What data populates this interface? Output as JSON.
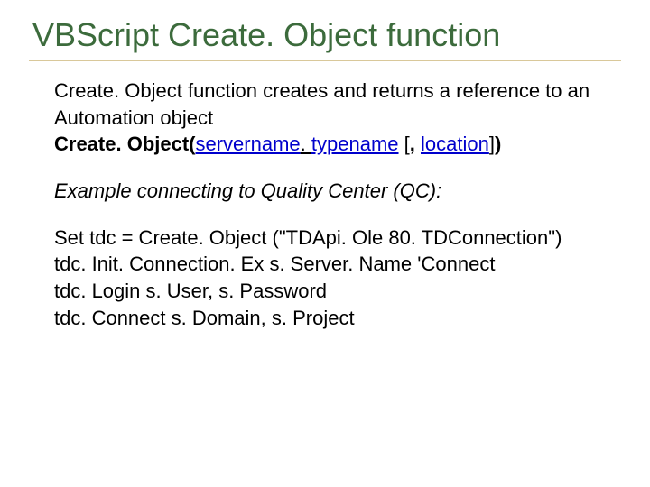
{
  "title": "VBScript Create. Object function",
  "intro": "Create. Object function creates and returns a reference to an Automation object",
  "syntax": {
    "lead": "Create. Object(",
    "servername": "servername",
    "dot": ". ",
    "typename": "typename",
    "space": " ",
    "openbracket": "[",
    "comma": ", ",
    "location": "location",
    "closebracket": "]",
    "closeparen": ")"
  },
  "example_title": "Example connecting to Quality Center (QC):",
  "code": {
    "l1": "Set tdc = Create. Object (\"TDApi. Ole 80. TDConnection\")",
    "l2": "tdc. Init. Connection. Ex s. Server. Name 'Connect",
    "l3": "tdc. Login s. User, s. Password",
    "l4": "tdc. Connect s. Domain, s. Project"
  }
}
